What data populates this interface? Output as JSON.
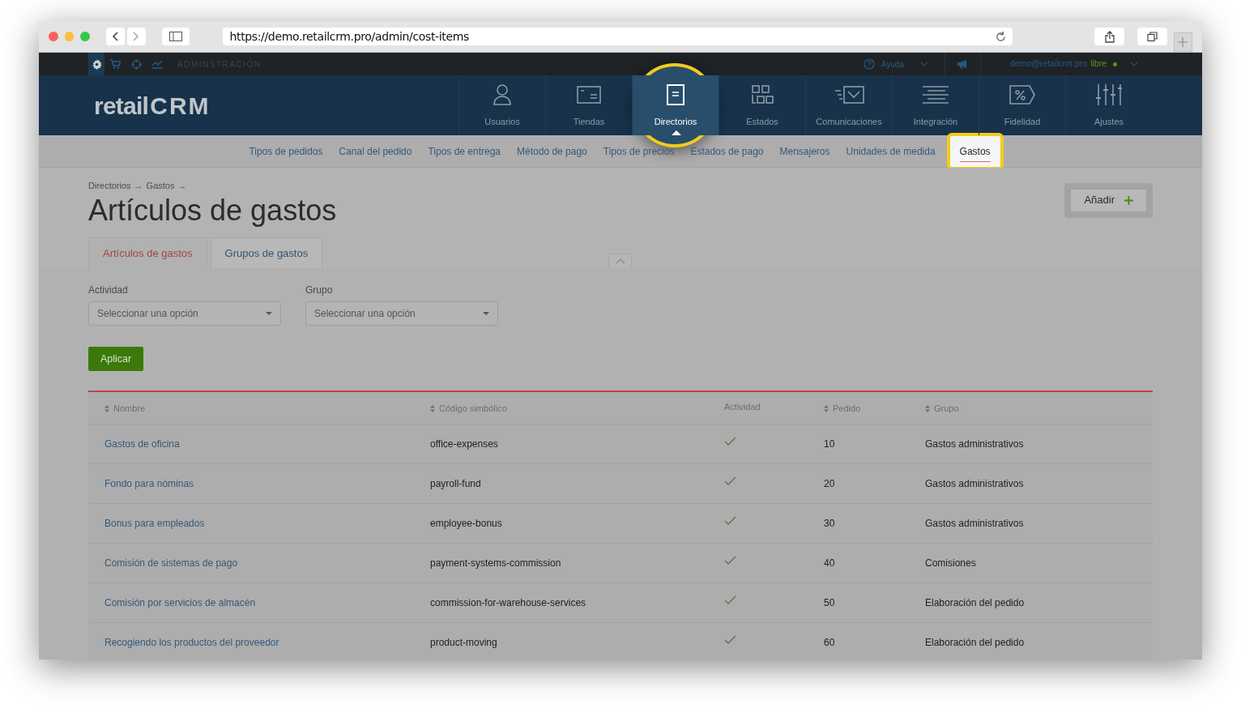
{
  "browser": {
    "url": "https://demo.retailcrm.pro/admin/cost-items"
  },
  "top_bar": {
    "modules": [
      {
        "selected": true
      },
      {
        "selected": false
      },
      {
        "selected": false
      },
      {
        "selected": false
      }
    ],
    "section_label": "ADMINSTRACIÓN",
    "help": "Ayuda",
    "user_email": "demo@retailcrm.pro",
    "plan": "libre"
  },
  "logo": {
    "text": "retail",
    "mark": "CRM"
  },
  "nav": [
    {
      "label": "Usuarios",
      "selected": false,
      "highlighted": false
    },
    {
      "label": "Tiendas",
      "selected": false,
      "highlighted": false
    },
    {
      "label": "Directorios",
      "selected": true,
      "highlighted": true
    },
    {
      "label": "Estados",
      "selected": false,
      "highlighted": false
    },
    {
      "label": "Comunicaciones",
      "selected": false,
      "highlighted": false
    },
    {
      "label": "Integración",
      "selected": false,
      "highlighted": false
    },
    {
      "label": "Fidelidad",
      "selected": false,
      "highlighted": false
    },
    {
      "label": "Ajustes",
      "selected": false,
      "highlighted": false
    }
  ],
  "subnav": [
    {
      "label": "Tipos de pedidos",
      "selected": false,
      "highlighted": false
    },
    {
      "label": "Canal del pedido",
      "selected": false,
      "highlighted": false
    },
    {
      "label": "Tipos de entrega",
      "selected": false,
      "highlighted": false
    },
    {
      "label": "Método de pago",
      "selected": false,
      "highlighted": false
    },
    {
      "label": "Tipos de precios",
      "selected": false,
      "highlighted": false
    },
    {
      "label": "Estados de pago",
      "selected": false,
      "highlighted": false
    },
    {
      "label": "Mensajeros",
      "selected": false,
      "highlighted": false
    },
    {
      "label": "Unidades de medida",
      "selected": false,
      "highlighted": false
    },
    {
      "label": "Gastos",
      "selected": true,
      "highlighted": true
    }
  ],
  "breadcrumb": [
    {
      "label": "Directorios",
      "separator": "→"
    },
    {
      "label": "Gastos",
      "separator": "→"
    }
  ],
  "title": "Artículos de gastos",
  "add_button": "Añadir",
  "tabs": [
    {
      "label": "Artículos de gastos",
      "selected": true
    },
    {
      "label": "Grupos de gastos",
      "selected": false
    }
  ],
  "filters": [
    {
      "label": "Actividad",
      "placeholder": "Seleccionar una opción"
    },
    {
      "label": "Grupo",
      "placeholder": "Seleccionar una opción"
    }
  ],
  "apply_button": "Aplicar",
  "table": {
    "columns": [
      {
        "label": "Nombre",
        "sortable": true
      },
      {
        "label": "Código simbólico",
        "sortable": true
      },
      {
        "label": "Actividad",
        "sortable": false
      },
      {
        "label": "Pedido",
        "sortable": true
      },
      {
        "label": "Grupo",
        "sortable": true
      }
    ],
    "rows": [
      {
        "name": "Gastos de oficina",
        "code": "office-expenses",
        "active": true,
        "order": "10",
        "group": "Gastos administrativos"
      },
      {
        "name": "Fondo para nóminas",
        "code": "payroll-fund",
        "active": true,
        "order": "20",
        "group": "Gastos administrativos"
      },
      {
        "name": "Bonus para empleados",
        "code": "employee-bonus",
        "active": true,
        "order": "30",
        "group": "Gastos administrativos"
      },
      {
        "name": "Comisión de sistemas de pago",
        "code": "payment-systems-commission",
        "active": true,
        "order": "40",
        "group": "Comisiones"
      },
      {
        "name": "Comisión por servicios de almacén",
        "code": "commission-for-warehouse-services",
        "active": true,
        "order": "50",
        "group": "Elaboración del pedido"
      },
      {
        "name": "Recogiendo los productos del proveedor",
        "code": "product-moving",
        "active": true,
        "order": "60",
        "group": "Elaboración del pedido"
      }
    ]
  }
}
